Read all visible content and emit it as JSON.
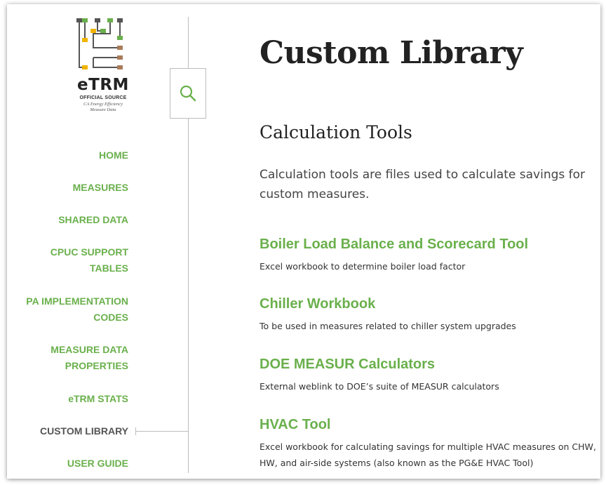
{
  "logo": {
    "word": "eTRM",
    "official": "OFFICIAL SOURCE",
    "subtitle_line1": "CA Energy Efficiency",
    "subtitle_line2": "Measure Data"
  },
  "search": {
    "icon": "search-icon"
  },
  "nav": {
    "items": [
      {
        "line1": "HOME",
        "line2": ""
      },
      {
        "line1": "MEASURES",
        "line2": ""
      },
      {
        "line1": "SHARED DATA",
        "line2": ""
      },
      {
        "line1": "CPUC SUPPORT",
        "line2": "TABLES"
      },
      {
        "line1": "PA IMPLEMENTATION",
        "line2": "CODES"
      },
      {
        "line1": "MEASURE DATA",
        "line2": "PROPERTIES"
      },
      {
        "line1": "eTRM STATS",
        "line2": ""
      },
      {
        "line1": "CUSTOM LIBRARY",
        "line2": ""
      },
      {
        "line1": "USER GUIDE",
        "line2": ""
      }
    ],
    "active": "CUSTOM LIBRARY"
  },
  "main": {
    "title": "Custom Library",
    "section": "Calculation Tools",
    "intro": "Calculation tools are files used to calculate savings for custom measures.",
    "tools": [
      {
        "name": "Boiler Load Balance and Scorecard Tool",
        "desc": "Excel workbook to determine boiler load factor"
      },
      {
        "name": "Chiller Workbook",
        "desc": "To be used in measures related to chiller system upgrades"
      },
      {
        "name": "DOE MEASUR Calculators",
        "desc": "External weblink to DOE’s suite of MEASUR calculators"
      },
      {
        "name": "HVAC Tool",
        "desc": "Excel workbook for calculating savings for multiple HVAC measures on CHW, HW, and air-side systems (also known as the PG&E HVAC Tool)"
      }
    ]
  },
  "colors": {
    "accent": "#6ab04c",
    "text": "#222222",
    "active_nav": "#555555",
    "rule": "#bdbdbd"
  }
}
